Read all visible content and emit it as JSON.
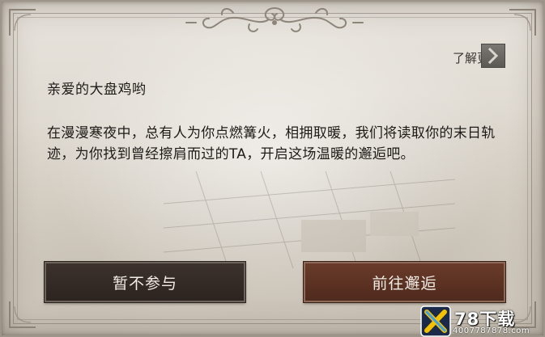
{
  "dialog": {
    "learn_more_label": "了解更多",
    "greeting": "亲爱的大盘鸡哟",
    "body": "在漫漫寒夜中，总有人为你点燃篝火，相拥取暖，我们将读取你的末日轨迹，为你找到曾经擦肩而过的TA，开启这场温暖的邂逅吧。",
    "decline_label": "暂不参与",
    "accept_label": "前往邂逅"
  },
  "watermark": {
    "brand": "78下载",
    "phone": "4007787878.com"
  },
  "icons": {
    "learn_more_arrow": "chevron-right-icon",
    "top_ornament": "scroll-ornament-icon",
    "watermark_badge": "x-logo-icon"
  },
  "colors": {
    "paper": "#e2ddd4",
    "decline_button": "#2f2622",
    "accept_button": "#5b3122",
    "text": "#1e1b18"
  }
}
